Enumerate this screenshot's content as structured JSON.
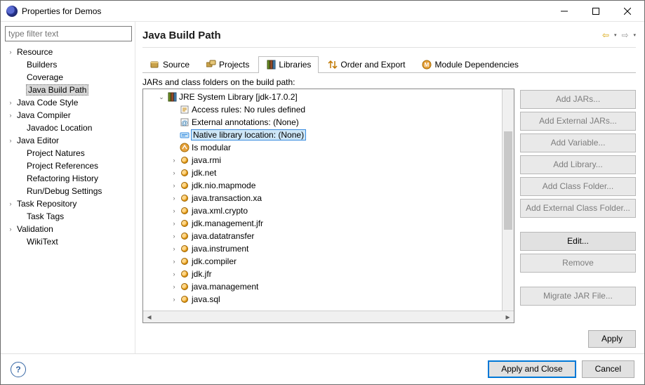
{
  "window": {
    "title": "Properties for Demos"
  },
  "filter_placeholder": "type filter text",
  "nav": [
    {
      "label": "Resource",
      "expander": true,
      "indent": 0,
      "selected": false
    },
    {
      "label": "Builders",
      "expander": false,
      "indent": 1,
      "selected": false
    },
    {
      "label": "Coverage",
      "expander": false,
      "indent": 1,
      "selected": false
    },
    {
      "label": "Java Build Path",
      "expander": false,
      "indent": 1,
      "selected": true
    },
    {
      "label": "Java Code Style",
      "expander": true,
      "indent": 0,
      "selected": false
    },
    {
      "label": "Java Compiler",
      "expander": true,
      "indent": 0,
      "selected": false
    },
    {
      "label": "Javadoc Location",
      "expander": false,
      "indent": 1,
      "selected": false
    },
    {
      "label": "Java Editor",
      "expander": true,
      "indent": 0,
      "selected": false
    },
    {
      "label": "Project Natures",
      "expander": false,
      "indent": 1,
      "selected": false
    },
    {
      "label": "Project References",
      "expander": false,
      "indent": 1,
      "selected": false
    },
    {
      "label": "Refactoring History",
      "expander": false,
      "indent": 1,
      "selected": false
    },
    {
      "label": "Run/Debug Settings",
      "expander": false,
      "indent": 1,
      "selected": false
    },
    {
      "label": "Task Repository",
      "expander": true,
      "indent": 0,
      "selected": false
    },
    {
      "label": "Task Tags",
      "expander": false,
      "indent": 1,
      "selected": false
    },
    {
      "label": "Validation",
      "expander": true,
      "indent": 0,
      "selected": false
    },
    {
      "label": "WikiText",
      "expander": false,
      "indent": 1,
      "selected": false
    }
  ],
  "page_heading": "Java Build Path",
  "tabs": [
    {
      "label": "Source",
      "active": false
    },
    {
      "label": "Projects",
      "active": false
    },
    {
      "label": "Libraries",
      "active": true
    },
    {
      "label": "Order and Export",
      "active": false
    },
    {
      "label": "Module Dependencies",
      "active": false
    }
  ],
  "caption": "JARs and class folders on the build path:",
  "tree": {
    "root_label": "JRE System Library [jdk-17.0.2]",
    "meta": [
      {
        "label": "Access rules: No rules defined",
        "icon": "rules"
      },
      {
        "label": "External annotations: (None)",
        "icon": "annot"
      },
      {
        "label": "Native library location: (None)",
        "icon": "native",
        "selected": true
      },
      {
        "label": "Is modular",
        "icon": "module"
      }
    ],
    "packages": [
      "java.rmi",
      "jdk.net",
      "jdk.nio.mapmode",
      "java.transaction.xa",
      "java.xml.crypto",
      "jdk.management.jfr",
      "java.datatransfer",
      "java.instrument",
      "jdk.compiler",
      "jdk.jfr",
      "java.management",
      "java.sql"
    ]
  },
  "side_buttons": [
    {
      "label": "Add JARs...",
      "enabled": false
    },
    {
      "label": "Add External JARs...",
      "enabled": false
    },
    {
      "label": "Add Variable...",
      "enabled": false
    },
    {
      "label": "Add Library...",
      "enabled": false
    },
    {
      "label": "Add Class Folder...",
      "enabled": false
    },
    {
      "label": "Add External Class Folder...",
      "enabled": false
    },
    {
      "label": "Edit...",
      "enabled": true,
      "gap_before": true
    },
    {
      "label": "Remove",
      "enabled": false
    },
    {
      "label": "Migrate JAR File...",
      "enabled": false,
      "gap_before": true
    }
  ],
  "apply_label": "Apply",
  "bottom": {
    "apply_close": "Apply and Close",
    "cancel": "Cancel"
  }
}
